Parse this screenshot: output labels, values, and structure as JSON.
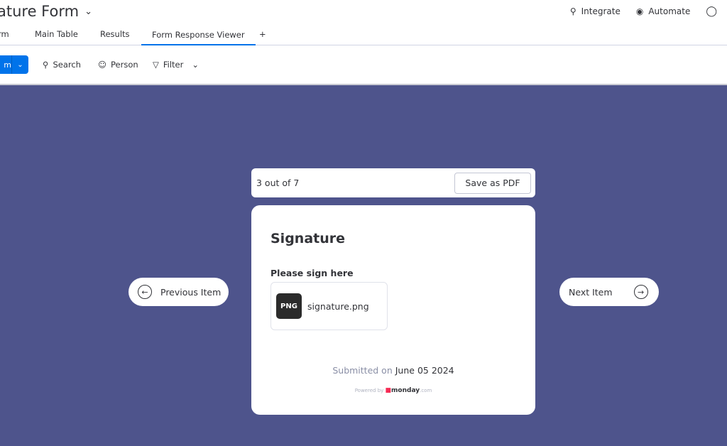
{
  "header": {
    "title": "ature Form",
    "integrate": "Integrate",
    "automate": "Automate"
  },
  "tabs": [
    {
      "label": "rm"
    },
    {
      "label": "Main Table"
    },
    {
      "label": "Results"
    },
    {
      "label": "Form Response Viewer"
    },
    {
      "label": "+"
    }
  ],
  "toolbar": {
    "new_label": "m",
    "search": "Search",
    "person": "Person",
    "filter": "Filter"
  },
  "viewer": {
    "counter": "3 out of 7",
    "save_pdf": "Save as PDF",
    "prev": "Previous Item",
    "next": "Next Item",
    "card": {
      "title": "Signature",
      "question": "Please sign here",
      "file_badge": "PNG",
      "file_name": "signature.png",
      "submitted_prefix": "Submitted on",
      "submitted_date": "June 05 2024",
      "powered_by": "Powered by",
      "brand": "monday",
      "brand_suffix": ".com"
    }
  },
  "colors": {
    "background": "#4e548c",
    "accent": "#0073ea"
  }
}
